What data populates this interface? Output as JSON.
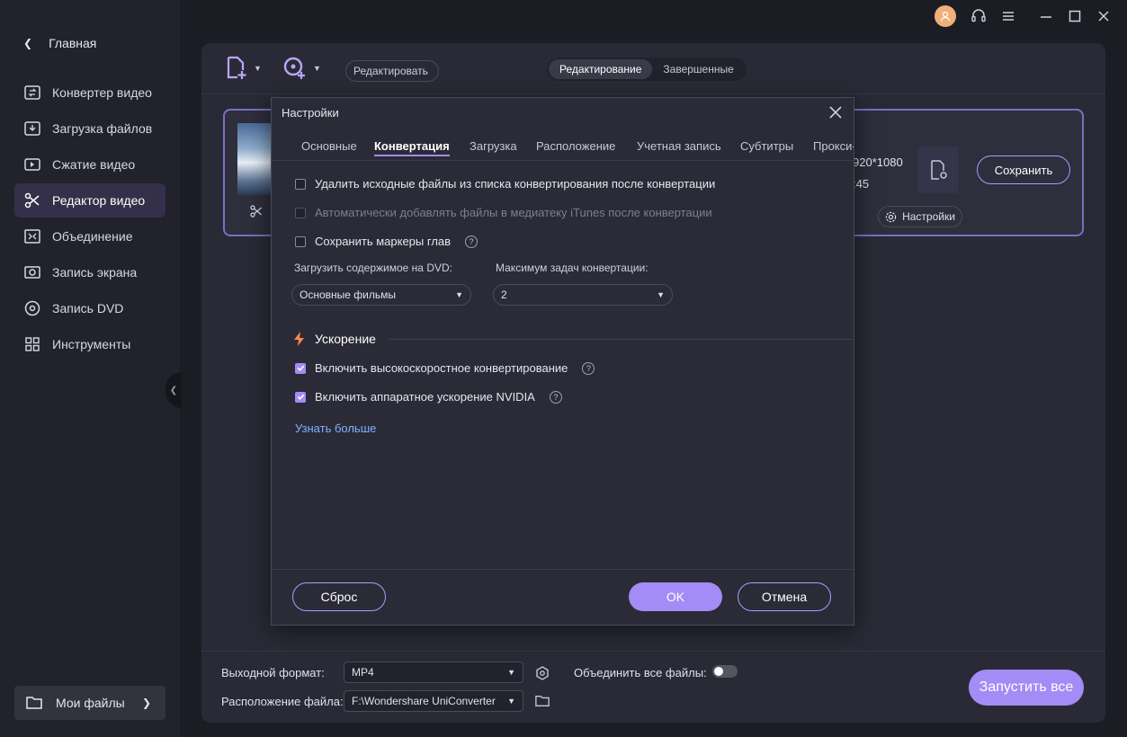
{
  "sidebar": {
    "home_label": "Главная",
    "items": [
      {
        "label": "Конвертер видео",
        "icon": "video-convert-icon"
      },
      {
        "label": "Загрузка файлов",
        "icon": "download-icon"
      },
      {
        "label": "Сжатие видео",
        "icon": "compress-icon"
      },
      {
        "label": "Редактор видео",
        "icon": "scissors-icon",
        "active": true
      },
      {
        "label": "Объединение",
        "icon": "merge-icon"
      },
      {
        "label": "Запись экрана",
        "icon": "screen-record-icon"
      },
      {
        "label": "Запись DVD",
        "icon": "dvd-icon"
      },
      {
        "label": "Инструменты",
        "icon": "tools-icon"
      }
    ],
    "my_files_label": "Мои файлы"
  },
  "toolbar": {
    "edit_select_value": "Редактировать",
    "segments": [
      "Редактирование",
      "Завершенные"
    ]
  },
  "file_card": {
    "resolution_text": "920*1080",
    "duration_text": ":45",
    "save_label": "Сохранить",
    "settings_label": "Настройки"
  },
  "bottom": {
    "output_format_label": "Выходной формат:",
    "output_format_value": "MP4",
    "file_location_label": "Расположение файла:",
    "file_location_value": "F:\\Wondershare UniConverter",
    "merge_label": "Объединить все файлы:",
    "run_all_label": "Запустить все"
  },
  "dialog": {
    "title": "Настройки",
    "tabs": [
      "Основные",
      "Конвертация",
      "Загрузка",
      "Расположение",
      "Учетная запись",
      "Субтитры",
      "Прокси-"
    ],
    "active_tab": 1,
    "checkboxes": [
      {
        "label": "Удалить исходные файлы из списка конвертирования после конвертации",
        "checked": false,
        "disabled": false
      },
      {
        "label": "Автоматически добавлять файлы в медиатеку iTunes после конвертации",
        "checked": false,
        "disabled": true
      },
      {
        "label": "Сохранить маркеры глав",
        "checked": false,
        "disabled": false
      }
    ],
    "dvd_label": "Загрузить содержимое на DVD:",
    "dvd_value": "Основные фильмы",
    "max_tasks_label": "Максимум задач конвертации:",
    "max_tasks_value": "2",
    "accel_title": "Ускорение",
    "accel_options": [
      {
        "label": "Включить высокоскоростное конвертирование",
        "checked": true
      },
      {
        "label": "Включить аппаратное ускорение NVIDIA",
        "checked": true
      }
    ],
    "learn_more": "Узнать больше",
    "reset_label": "Сброс",
    "ok_label": "OK",
    "cancel_label": "Отмена"
  },
  "colors": {
    "accent": "#a58bf5",
    "link": "#7fb2ff",
    "background": "#1c1c24",
    "panel": "#2a2a36"
  }
}
